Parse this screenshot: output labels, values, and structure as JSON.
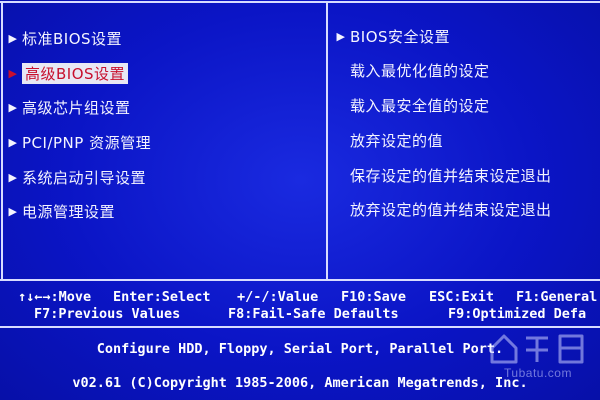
{
  "left_menu": {
    "items": [
      {
        "label": "标准BIOS设置",
        "selected": false
      },
      {
        "label": "高级BIOS设置",
        "selected": true
      },
      {
        "label": "高级芯片组设置",
        "selected": false
      },
      {
        "label": "PCI/PNP 资源管理",
        "selected": false
      },
      {
        "label": "系统启动引导设置",
        "selected": false
      },
      {
        "label": "电源管理设置",
        "selected": false
      }
    ]
  },
  "right_menu": {
    "items": [
      {
        "label": "BIOS安全设置",
        "has_arrow": true
      },
      {
        "label": "载入最优化值的设定",
        "has_arrow": false
      },
      {
        "label": "载入最安全值的设定",
        "has_arrow": false
      },
      {
        "label": "放弃设定的值",
        "has_arrow": false
      },
      {
        "label": "保存设定的值并结束设定退出",
        "has_arrow": false
      },
      {
        "label": "放弃设定的值并结束设定退出",
        "has_arrow": false
      }
    ]
  },
  "help_bar": {
    "row1": {
      "move": "↑↓←→:Move",
      "select": "Enter:Select",
      "value": "+/-/:Value",
      "save": "F10:Save",
      "exit": "ESC:Exit",
      "general": "F1:General"
    },
    "row2": {
      "previous": "F7:Previous Values",
      "failsafe": "F8:Fail-Safe Defaults",
      "optimized": "F9:Optimized Defa"
    }
  },
  "status": {
    "description": "Configure HDD, Floppy, Serial Port, Parallel Port.",
    "copyright": "v02.61 (C)Copyright 1985-2006, American Megatrends, Inc."
  },
  "watermark": {
    "text": "Tubatu.com"
  },
  "colors": {
    "background": "#0b15c6",
    "frame": "#d8dcff",
    "highlight_bg": "#e8e8f4",
    "highlight_text": "#c8102e",
    "text": "#ffffff"
  }
}
